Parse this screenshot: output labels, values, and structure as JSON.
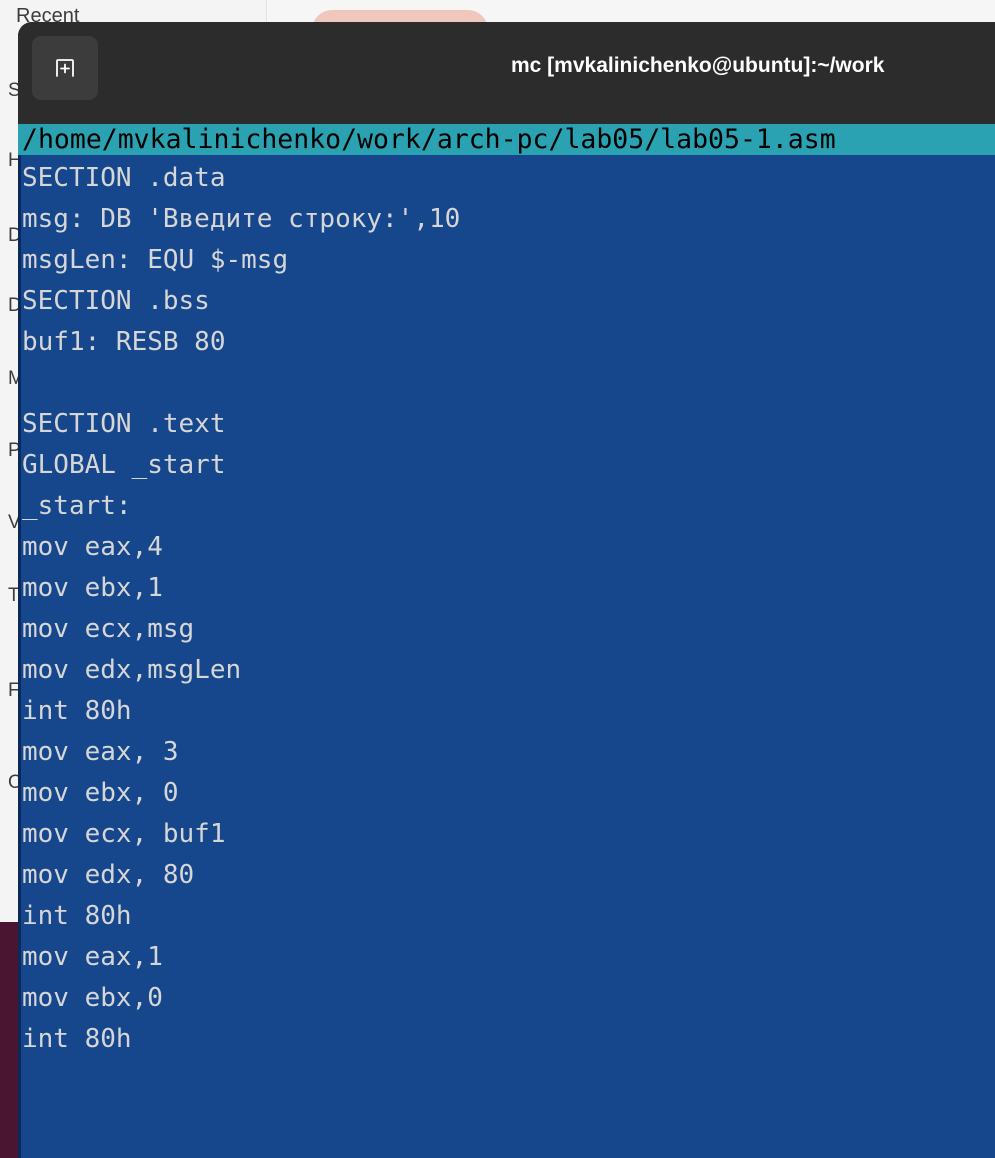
{
  "background_window": {
    "sidebar_top_label": "Recent",
    "cropped_letters": [
      "S",
      "H",
      "D",
      "D",
      "M",
      "P",
      "V",
      "T",
      "F",
      "O"
    ]
  },
  "terminal": {
    "title": "mc [mvkalinichenko@ubuntu]:~/work",
    "new_tab_icon": "new-tab-icon",
    "editor": {
      "file_path": "/home/mvkalinichenko/work/arch-pc/lab05/lab05-1.asm",
      "lines": [
        "SECTION .data",
        "msg: DB 'Введите строку:',10",
        "msgLen: EQU $-msg",
        "SECTION .bss",
        "buf1: RESB 80",
        "",
        "SECTION .text",
        "GLOBAL _start",
        "_start:",
        "mov eax,4",
        "mov ebx,1",
        "mov ecx,msg",
        "mov edx,msgLen",
        "int 80h",
        "mov eax, 3",
        "mov ebx, 0",
        "mov ecx, buf1",
        "mov edx, 80",
        "int 80h",
        "mov eax,1",
        "mov ebx,0",
        "int 80h"
      ]
    }
  },
  "colors": {
    "editor_background": "#16478c",
    "path_bar": "#2aa2b1",
    "code_text": "#d6d6d6",
    "titlebar": "#2c2c2c"
  }
}
